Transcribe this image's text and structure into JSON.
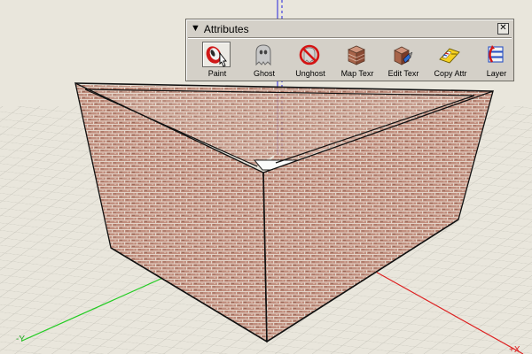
{
  "palette": {
    "title": "Attributes",
    "collapse_glyph": "▼",
    "close_glyph": "✕",
    "tools": [
      {
        "label": "Paint",
        "icon": "paint-bucket-icon",
        "active": true
      },
      {
        "label": "Ghost",
        "icon": "ghost-icon",
        "active": false
      },
      {
        "label": "Unghost",
        "icon": "unghost-icon",
        "active": false
      },
      {
        "label": "Map Texr",
        "icon": "map-texture-icon",
        "active": false
      },
      {
        "label": "Edit Texr",
        "icon": "edit-texture-icon",
        "active": false
      },
      {
        "label": "Copy Attr",
        "icon": "copy-attributes-icon",
        "active": false
      },
      {
        "label": "Layer",
        "icon": "layer-icon",
        "active": false
      }
    ]
  },
  "viewport": {
    "axis_labels": {
      "y": "-Y",
      "x": "+X"
    },
    "colors": {
      "background": "#e9e6dc",
      "grid": "#c4c2b8",
      "brick": "#c08e7e",
      "mortar": "#e8d8cc",
      "y_axis": "#22cc22",
      "x_axis": "#dd2222",
      "z_axis": "#2222dd"
    }
  }
}
